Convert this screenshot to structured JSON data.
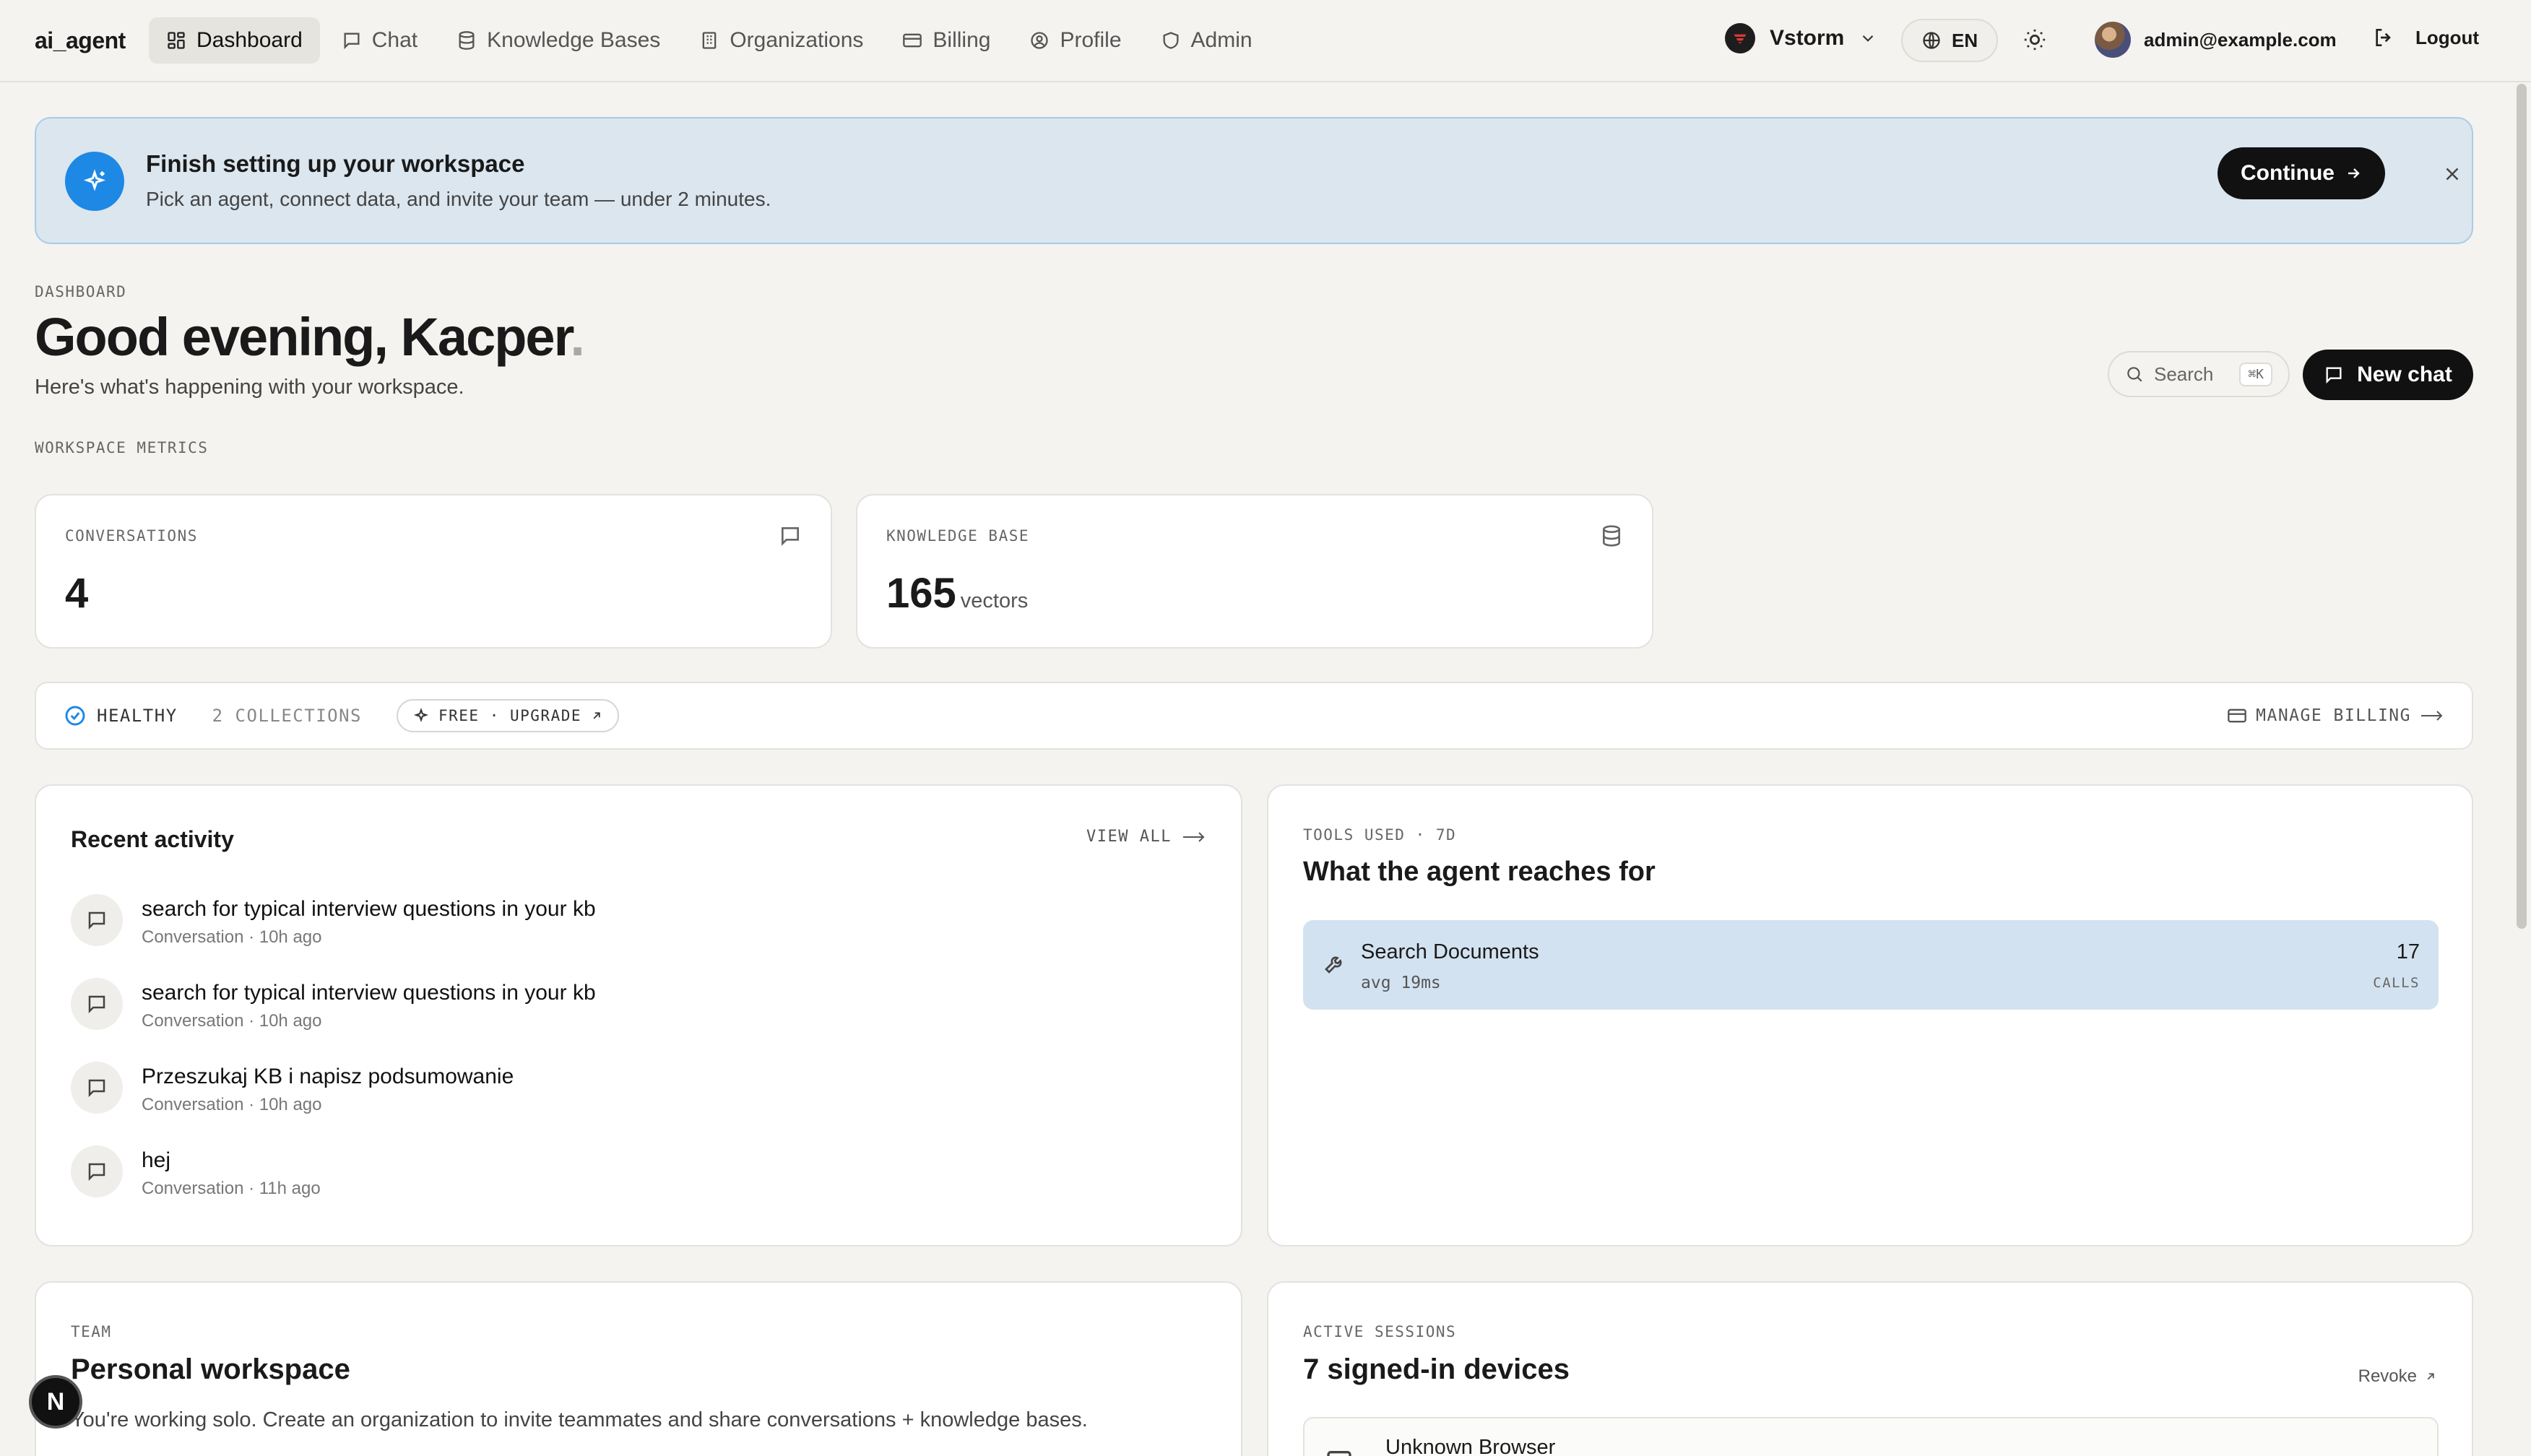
{
  "app": {
    "brand": "ai_agent"
  },
  "nav": {
    "items": [
      {
        "label": "Dashboard",
        "icon": "grid-icon",
        "active": true
      },
      {
        "label": "Chat",
        "icon": "chat-bubble-icon",
        "active": false
      },
      {
        "label": "Knowledge Bases",
        "icon": "database-icon",
        "active": false
      },
      {
        "label": "Organizations",
        "icon": "building-icon",
        "active": false
      },
      {
        "label": "Billing",
        "icon": "credit-card-icon",
        "active": false
      },
      {
        "label": "Profile",
        "icon": "user-circle-icon",
        "active": false
      },
      {
        "label": "Admin",
        "icon": "shield-icon",
        "active": false
      }
    ]
  },
  "topbar": {
    "org_name": "Vstorm",
    "language": "EN",
    "user_email": "admin@example.com",
    "logout_label": "Logout"
  },
  "banner": {
    "title": "Finish setting up your workspace",
    "subtitle": "Pick an agent, connect data, and invite your team — under 2 minutes.",
    "continue_label": "Continue"
  },
  "header": {
    "breadcrumb": "DASHBOARD",
    "greeting": "Good evening, Kacper",
    "greeting_dot": ".",
    "subtitle": "Here's what's happening with your workspace.",
    "search_placeholder": "Search",
    "search_shortcut": "⌘K",
    "new_chat_label": "New chat",
    "metrics_label": "WORKSPACE METRICS"
  },
  "metrics": {
    "conversations": {
      "label": "CONVERSATIONS",
      "value": "4"
    },
    "knowledge_base": {
      "label": "KNOWLEDGE BASE",
      "value": "165",
      "unit": "vectors"
    }
  },
  "status": {
    "health": "HEALTHY",
    "collections": "2 COLLECTIONS",
    "plan": "FREE · UPGRADE",
    "manage_billing": "MANAGE BILLING",
    "health_color": "#1e88e5"
  },
  "activity": {
    "title": "Recent activity",
    "view_all": "VIEW ALL",
    "items": [
      {
        "title": "search for typical interview questions in your kb",
        "meta": "Conversation · 10h ago"
      },
      {
        "title": "search for typical interview questions in your kb",
        "meta": "Conversation · 10h ago"
      },
      {
        "title": "Przeszukaj KB i napisz podsumowanie",
        "meta": "Conversation · 10h ago"
      },
      {
        "title": "hej",
        "meta": "Conversation · 11h ago"
      }
    ]
  },
  "tools": {
    "eyebrow": "TOOLS USED · 7D",
    "title": "What the agent reaches for",
    "items": [
      {
        "name": "Search Documents",
        "avg": "avg 19ms",
        "count": "17",
        "count_label": "CALLS"
      }
    ]
  },
  "team": {
    "eyebrow": "TEAM",
    "title": "Personal workspace",
    "text": "You're working solo. Create an organization to invite teammates and share conversations + knowledge bases."
  },
  "sessions": {
    "eyebrow": "ACTIVE SESSIONS",
    "title": "7 signed-in devices",
    "revoke_label": "Revoke",
    "items": [
      {
        "name": "Unknown Browser"
      }
    ]
  },
  "badge": {
    "letter": "N"
  },
  "colors": {
    "accent": "#1e88e5",
    "banner_bg": "#dbe6ef",
    "tool_row_bg": "#d3e2f0",
    "page_bg": "#f4f3f0"
  }
}
